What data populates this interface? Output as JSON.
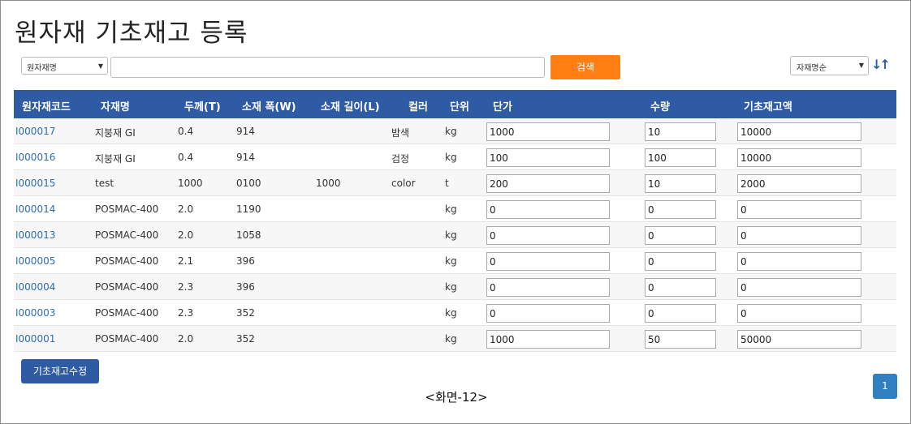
{
  "page": {
    "title": "원자재 기초재고 등록",
    "caption": "<화면-12>"
  },
  "search": {
    "field_select": "원자재명",
    "input_value": "",
    "button_label": "검색",
    "sort_select": "자재명순",
    "sort_icon": "sort-arrows-icon"
  },
  "table": {
    "columns": [
      "원자재코드",
      "자재명",
      "두께(T)",
      "소재 폭(W)",
      "소재 길이(L)",
      "컬러",
      "단위",
      "단가",
      "수량",
      "기초재고액"
    ],
    "rows": [
      {
        "code": "I000017",
        "name": "지붕재 GI",
        "thickness": "0.4",
        "width": "914",
        "length": "",
        "color": "밤색",
        "unit": "kg",
        "price": "1000",
        "qty": "10",
        "stock": "10000"
      },
      {
        "code": "I000016",
        "name": "지붕재 GI",
        "thickness": "0.4",
        "width": "914",
        "length": "",
        "color": "검정",
        "unit": "kg",
        "price": "100",
        "qty": "100",
        "stock": "10000"
      },
      {
        "code": "I000015",
        "name": "test",
        "thickness": "1000",
        "width": "0100",
        "length": "1000",
        "color": "color",
        "unit": "t",
        "price": "200",
        "qty": "10",
        "stock": "2000"
      },
      {
        "code": "I000014",
        "name": "POSMAC-400",
        "thickness": "2.0",
        "width": "1190",
        "length": "",
        "color": "",
        "unit": "kg",
        "price": "0",
        "qty": "0",
        "stock": "0"
      },
      {
        "code": "I000013",
        "name": "POSMAC-400",
        "thickness": "2.0",
        "width": "1058",
        "length": "",
        "color": "",
        "unit": "kg",
        "price": "0",
        "qty": "0",
        "stock": "0"
      },
      {
        "code": "I000005",
        "name": "POSMAC-400",
        "thickness": "2.1",
        "width": "396",
        "length": "",
        "color": "",
        "unit": "kg",
        "price": "0",
        "qty": "0",
        "stock": "0"
      },
      {
        "code": "I000004",
        "name": "POSMAC-400",
        "thickness": "2.3",
        "width": "396",
        "length": "",
        "color": "",
        "unit": "kg",
        "price": "0",
        "qty": "0",
        "stock": "0"
      },
      {
        "code": "I000003",
        "name": "POSMAC-400",
        "thickness": "2.3",
        "width": "352",
        "length": "",
        "color": "",
        "unit": "kg",
        "price": "0",
        "qty": "0",
        "stock": "0"
      },
      {
        "code": "I000001",
        "name": "POSMAC-400",
        "thickness": "2.0",
        "width": "352",
        "length": "",
        "color": "",
        "unit": "kg",
        "price": "1000",
        "qty": "50",
        "stock": "50000"
      }
    ]
  },
  "footer": {
    "edit_button": "기초재고수정",
    "page_number": "1"
  },
  "colors": {
    "header_bg": "#2f5ba5",
    "search_button": "#ff7f15",
    "link": "#2f6cb1",
    "pagination": "#2f7fc1"
  }
}
